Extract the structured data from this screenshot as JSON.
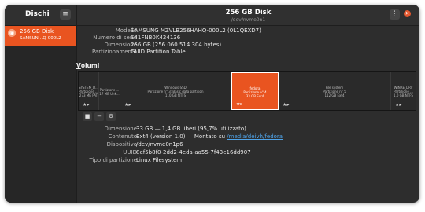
{
  "app": {
    "title": "Dischi",
    "menu_icon": "hamburger-icon"
  },
  "header": {
    "title": "256 GB Disk",
    "subtitle": "/dev/nvme0n1",
    "menu_icon": "kebab-icon",
    "close_icon": "close-icon"
  },
  "sidebar": {
    "items": [
      {
        "name": "256 GB Disk",
        "model": "SAMSUN…Q-000L2",
        "selected": true
      }
    ]
  },
  "disk_info": [
    {
      "label": "Modello",
      "value": "SAMSUNG MZVLB256HAHQ-000L2 (0L1QEXD7)"
    },
    {
      "label": "Numero di serie",
      "value": "S41FNB0K424136"
    },
    {
      "label": "Dimensione",
      "value": "256 GB (256.060.514.304 bytes)"
    },
    {
      "label": "Partizionamento",
      "value": "GUID Partition Table"
    }
  ],
  "volumes": {
    "title_mnemonic": "V",
    "title_rest": "olumi",
    "partitions": [
      {
        "label_lines": [
          "SYSTEM_D...",
          "Partizione ...",
          "273 MB FAT"
        ],
        "selected": false
      },
      {
        "label_lines": [
          "Partizione ...",
          "17 MB Unk..."
        ],
        "selected": false
      },
      {
        "label_lines": [
          "Windows-SSD",
          "Partizione n° 3: Basic data partition",
          "110 GB NTFS"
        ],
        "selected": false
      },
      {
        "label_lines": [
          "fedora",
          "Partizione n° 4",
          "33 GB Ext4"
        ],
        "selected": true
      },
      {
        "label_lines": [
          "File system",
          "Partizione n° 5",
          "112 GB Ext4"
        ],
        "selected": false
      },
      {
        "label_lines": [
          "WINRE_DRV",
          "Partizione ...",
          "1,0 GB NTFS"
        ],
        "selected": false
      }
    ],
    "tool_icons": [
      "stop-icon",
      "minus-icon",
      "gear-icon"
    ]
  },
  "partition_info": {
    "size": {
      "label": "Dimensione",
      "value": "33 GB — 1,4 GB liberi (95,7% utilizzato)"
    },
    "contents": {
      "label": "Contenuto",
      "prefix": "Ext4 (version 1.0) — Montato su ",
      "link": "/media/deivh/fedora"
    },
    "device": {
      "label": "Dispositivo",
      "value": "/dev/nvme0n1p6"
    },
    "uuid": {
      "label": "UUID",
      "value": "8ef5b8f0-2dd2-4eda-aa55-7f43e16dd907"
    },
    "type": {
      "label": "Tipo di partizione",
      "value": "Linux Filesystem"
    }
  },
  "colors": {
    "accent": "#e95420",
    "window_bg": "#2d2d2d",
    "link": "#4fa3e8"
  }
}
